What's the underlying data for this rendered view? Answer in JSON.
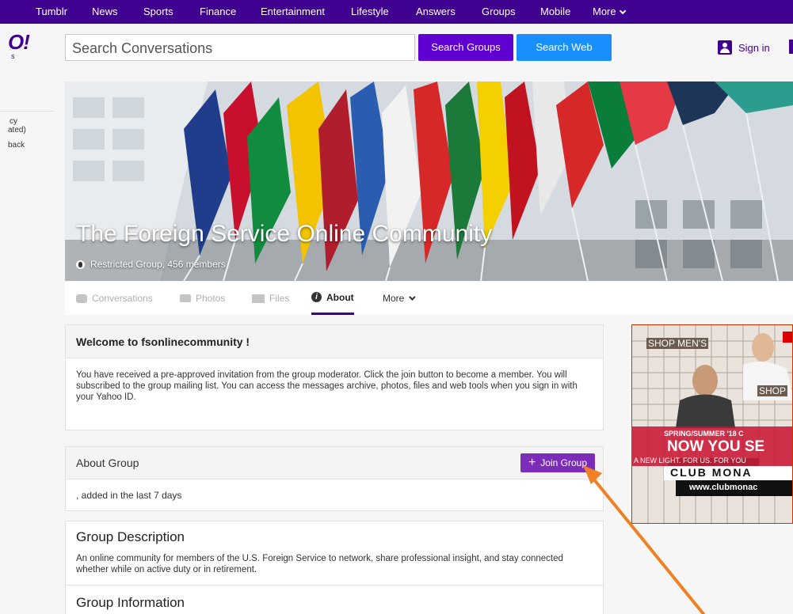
{
  "topnav": {
    "items": [
      "Tumblr",
      "News",
      "Sports",
      "Finance",
      "Entertainment",
      "Lifestyle",
      "Answers",
      "Groups",
      "Mobile"
    ],
    "more_label": "More"
  },
  "header": {
    "logo_text": "O!",
    "search_placeholder": "Search Conversations",
    "search_groups_label": "Search Groups",
    "search_web_label": "Search Web",
    "signin_label": "Sign in"
  },
  "left_fragment": {
    "lines": [
      "cy",
      "ated)",
      "back"
    ]
  },
  "hero": {
    "title": "The Foreign Service Online Community",
    "subtitle": "Restricted Group, 456 members"
  },
  "tabs": {
    "conversations": "Conversations",
    "photos": "Photos",
    "files": "Files",
    "about": "About",
    "more": "More"
  },
  "welcome": {
    "title": "Welcome to fsonlinecommunity !",
    "body": "You have received a pre-approved invitation from the group moderator. Click the join button to become a member. You will subscribed to the group mailing list. You can access the messages archive, photos, files and web tools when you sign in with your Yahoo ID."
  },
  "about": {
    "title": "About Group",
    "join_label": "Join Group",
    "added_text": ", added in the last 7 days"
  },
  "description": {
    "title": "Group Description",
    "body": "An online community for members of the U.S. Foreign Service to network, share professional insight, and stay connected whether while on active duty or in retirement."
  },
  "group_info": {
    "title": "Group Information"
  },
  "ad": {
    "shop_mens": "SHOP MEN'S",
    "shop_womens": "SHOP",
    "season": "SPRING/SUMMER '18 C",
    "headline": "NOW YOU SE",
    "tagline": "A NEW LIGHT. FOR US. FOR YOU",
    "brand": "CLUB MONA",
    "url": "www.clubmonac"
  },
  "colors": {
    "nav_purple": "#400090",
    "search_groups": "#5f01d1",
    "search_web": "#188fff",
    "join_button": "#7b2cb8",
    "annotation_arrow": "#f08024"
  }
}
